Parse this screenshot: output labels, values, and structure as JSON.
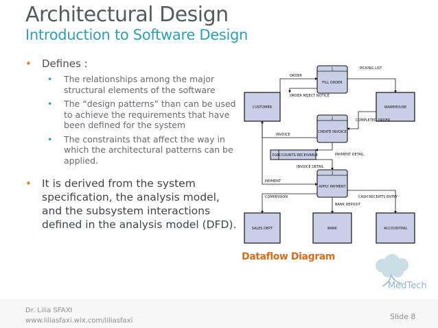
{
  "header": {
    "title": "Architectural Design",
    "subtitle": "Introduction to Software Design"
  },
  "bullets": {
    "defines_label": "Defines :",
    "sub_items": [
      "The relationships among the major structural elements of the software",
      "The “design patterns” than can be used to achieve the requirements that have been defined for the system",
      "The constraints that affect the way in which the architectural patterns can be applied."
    ],
    "derived": "It is derived from the system specification, the analysis model, and the subsystem interactions defined in the analysis model (DFD)."
  },
  "diagram": {
    "caption": "Dataflow Diagram",
    "nodes": {
      "customer": "CUSTOMER",
      "warehouse": "WAREHOUSE",
      "fill_order": "FILL ORDER",
      "create_invoice": "CREATE INVOICE",
      "apply_payment": "APPLY PAYMENT",
      "accounts_receivable": "ACCOUNTS RECEIVABLE",
      "sales_dept": "SALES DEPT",
      "bank": "BANK",
      "accounting": "ACCOUNTING"
    },
    "numbers": [
      "1",
      "2",
      "3",
      "D1"
    ],
    "flows": {
      "order": "ORDER",
      "picking_list": "PICKING LIST",
      "order_reject_notice": "ORDER REJECT NOTICE",
      "completed_order": "COMPLETED ORDER",
      "invoice": "INVOICE",
      "invoice_detail": "INVOICE DETAIL",
      "payment_detail": "PAYMENT DETAIL",
      "payment": "PAYMENT",
      "commission": "COMMISSION",
      "bank_deposit": "BANK DEPOSIT",
      "cash_receipts_entry": "CASH RECEIPTS ENTRY"
    }
  },
  "brand": {
    "logo_text": "MedTech"
  },
  "footer": {
    "author": "Dr. Lilia SFAXI",
    "url": "www.liliasfaxi.wix.com/liliasfaxi",
    "slide": "Slide 8"
  }
}
